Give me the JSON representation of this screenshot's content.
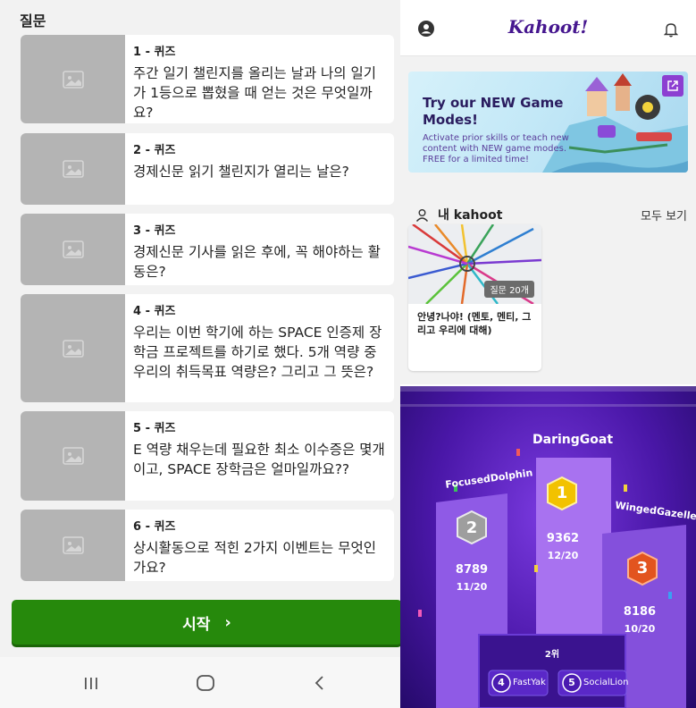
{
  "left": {
    "section_title": "질문",
    "questions": [
      {
        "num": "1 - 퀴즈",
        "text": "주간 일기 챌린지를 올리는 날과 나의 일기가 1등으로 뽑혔을 때 얻는 것은 무엇일까요?"
      },
      {
        "num": "2 - 퀴즈",
        "text": "경제신문 읽기 챌린지가 열리는 날은?"
      },
      {
        "num": "3 - 퀴즈",
        "text": "경제신문 기사를 읽은 후에, 꼭 해야하는 활동은?"
      },
      {
        "num": "4 - 퀴즈",
        "text": "우리는 이번 학기에 하는 SPACE 인증제 장학금 프로젝트를 하기로 했다. 5개 역량 중 우리의 취득목표 역량은? 그리고 그 뜻은?"
      },
      {
        "num": "5 - 퀴즈",
        "text": "E 역량 채우는데 필요한 최소 이수증은 몇개이고, SPACE 장학금은 얼마일까요??"
      },
      {
        "num": "6 - 퀴즈",
        "text": "상시활동으로 적힌 2가지 이벤트는 무엇인가요?"
      }
    ],
    "start_label": "시작",
    "start_chevron": "›"
  },
  "right": {
    "brand": "Kahoot!",
    "promo": {
      "title": "Try our NEW Game Modes!",
      "desc": "Activate prior skills or teach new content with NEW game modes. FREE for a limited time!"
    },
    "my_kahoot_label": "내 kahoot",
    "see_all": "모두 보기",
    "kahoot_card": {
      "question_count": "질문 20개",
      "title": "안녕?나야! (멘토, 멘티, 그리고 우리에 대해)"
    }
  },
  "podium": {
    "first": {
      "name": "DaringGoat",
      "rank": "1",
      "score": "9362",
      "correct": "12/20"
    },
    "second": {
      "name": "FocusedDolphin",
      "rank": "2",
      "score": "8789",
      "correct": "11/20"
    },
    "third": {
      "name": "WingedGazelle",
      "rank": "3",
      "score": "8186",
      "correct": "10/20"
    },
    "runners_label": "2위",
    "fourth": {
      "rank": "4",
      "name": "FastYak"
    },
    "fifth": {
      "rank": "5",
      "name": "SocialLion"
    }
  },
  "colors": {
    "start_green": "#26890c",
    "kahoot_purple": "#46178f",
    "thumb_gray": "#b4b4b4"
  }
}
